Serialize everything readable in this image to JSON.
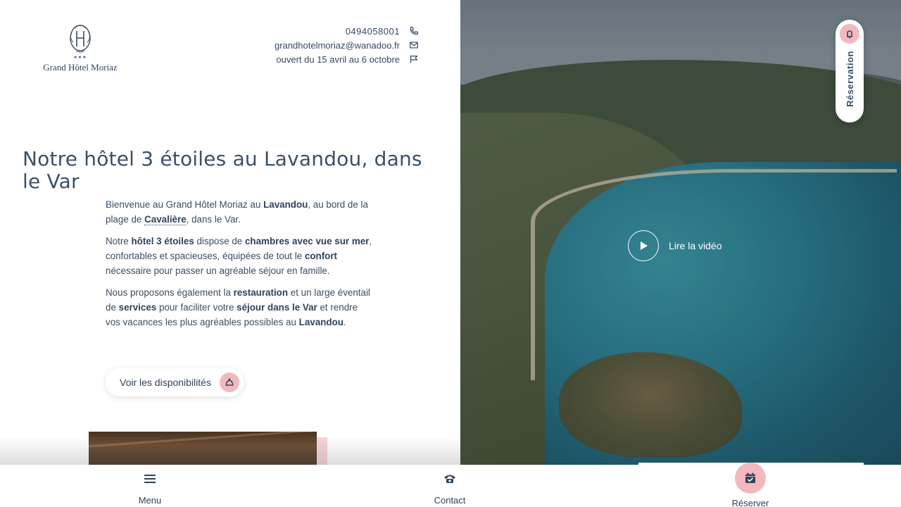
{
  "header": {
    "logo_name": "Grand Hôtel Moriaz",
    "logo_stars": "★★★",
    "phone": "0494058001",
    "email": "grandhotelmoriaz@wanadoo.fr",
    "opening": "ouvert du 15 avril au 6 octobre"
  },
  "main": {
    "title": "Notre hôtel 3 étoiles au Lavandou, dans le Var",
    "p1_a": "Bienvenue au Grand Hôtel Moriaz au ",
    "p1_b": "Lavandou",
    "p1_c": ", au bord de la plage de ",
    "p1_d": "Cavalière",
    "p1_e": ", dans le Var.",
    "p2_a": "Notre ",
    "p2_b": "hôtel 3 étoiles",
    "p2_c": " dispose de ",
    "p2_d": "chambres avec vue sur mer",
    "p2_e": ", confortables et spacieuses, équipées de tout le ",
    "p2_f": "confort",
    "p2_g": " nécessaire pour passer un agréable séjour en famille.",
    "p3_a": "Nous proposons également la ",
    "p3_b": "restauration",
    "p3_c": " et un large éventail de ",
    "p3_d": "services",
    "p3_e": " pour faciliter votre ",
    "p3_f": "séjour dans le Var",
    "p3_g": " et rendre vos vacances les plus agréables possibles au ",
    "p3_h": "Lavandou",
    "p3_i": ".",
    "availability_button": "Voir les disponibilités"
  },
  "hero": {
    "video_label": "Lire la vidéo",
    "reservation_tab": "Réservation"
  },
  "bottom_nav": {
    "menu": "Menu",
    "contact": "Contact",
    "reserver": "Réserver"
  },
  "colors": {
    "text": "#344a63",
    "accent_pink": "#f3b8bd"
  }
}
